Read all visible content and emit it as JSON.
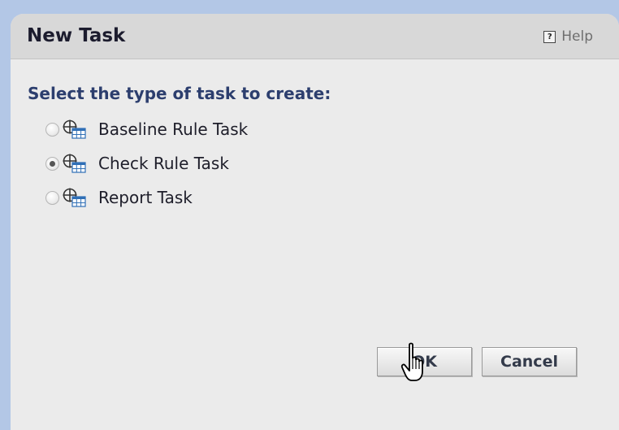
{
  "dialog": {
    "title": "New Task",
    "help_label": "Help",
    "help_icon": "?",
    "prompt": "Select the type of task to create:",
    "options": [
      {
        "label": "Baseline Rule Task",
        "checked": false,
        "icon": "task-grid-icon"
      },
      {
        "label": "Check Rule Task",
        "checked": true,
        "icon": "task-grid-icon"
      },
      {
        "label": "Report Task",
        "checked": false,
        "icon": "task-grid-icon"
      }
    ],
    "ok_label": "OK",
    "cancel_label": "Cancel"
  },
  "colors": {
    "background": "#b3c7e6",
    "dialog_body": "#ebebeb",
    "title_bar": "#d8d8d8",
    "prompt_text": "#2c3e6e"
  },
  "cursor": "hand-pointer-icon"
}
